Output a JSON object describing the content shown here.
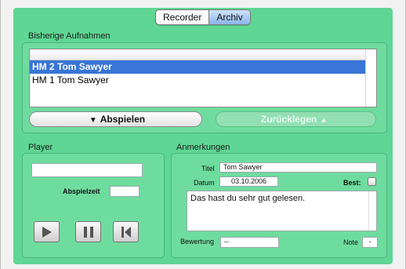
{
  "tabs": [
    {
      "label": "Recorder",
      "active": false
    },
    {
      "label": "Archiv",
      "active": true
    }
  ],
  "recordings": {
    "title": "Bisherige Aufnahmen",
    "items": [
      {
        "label": "HM 2 Tom Sawyer",
        "selected": true
      },
      {
        "label": "HM 1 Tom Sawyer",
        "selected": false
      }
    ],
    "play_label": "Abspielen",
    "back_label": "Zurücklegen"
  },
  "player": {
    "title": "Player",
    "name_value": "",
    "playtime_label": "Abspielzeit",
    "playtime_value": ""
  },
  "notes": {
    "title": "Anmerkungen",
    "titel_label": "Titel",
    "titel_value": "Tom Sawyer",
    "datum_label": "Datum",
    "datum_value": "03.10.2006",
    "best_label": "Best:",
    "best_checked": false,
    "text_value": "Das hast du sehr gut gelesen.",
    "bewertung_label": "Bewertung",
    "bewertung_value": "--",
    "note_label": "Note",
    "note_value": "-"
  },
  "colors": {
    "panel": "#5fd693",
    "group": "#6fdc9f",
    "selection": "#3875d7"
  }
}
